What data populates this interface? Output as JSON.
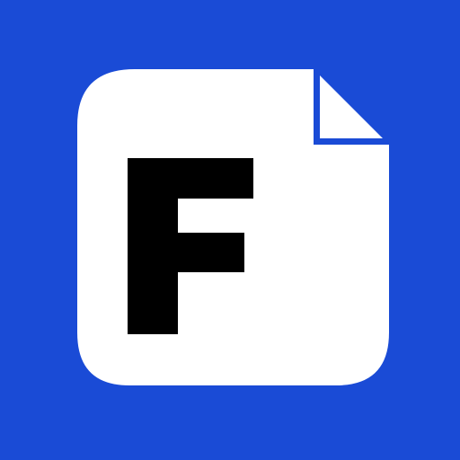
{
  "app_icon": {
    "name": "file-document-app-icon",
    "letter": "F",
    "colors": {
      "background": "#1a4bd6",
      "document": "#ffffff",
      "letter": "#000000"
    }
  }
}
